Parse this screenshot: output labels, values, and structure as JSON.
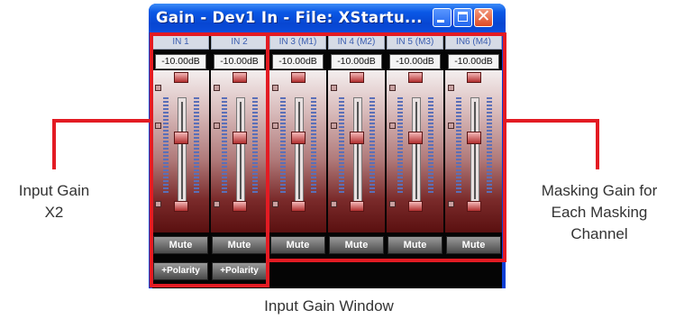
{
  "window": {
    "title": "Gain - Dev1 In  -  File: XStartu...",
    "controls": {
      "minimize": "minimize-icon",
      "maximize": "maximize-icon",
      "close": "close-icon",
      "close_glyph": "✕"
    }
  },
  "channels": [
    {
      "label": "IN 1",
      "gain": "-10.00dB",
      "mute": "Mute",
      "polarity": "+Polarity"
    },
    {
      "label": "IN 2",
      "gain": "-10.00dB",
      "mute": "Mute",
      "polarity": "+Polarity"
    },
    {
      "label": "IN 3 (M1)",
      "gain": "-10.00dB",
      "mute": "Mute"
    },
    {
      "label": "IN 4 (M2)",
      "gain": "-10.00dB",
      "mute": "Mute"
    },
    {
      "label": "IN 5 (M3)",
      "gain": "-10.00dB",
      "mute": "Mute"
    },
    {
      "label": "IN6 (M4)",
      "gain": "-10.00dB",
      "mute": "Mute"
    }
  ],
  "annotations": {
    "left_line1": "Input Gain",
    "left_line2": "X2",
    "right_line1": "Masking Gain for",
    "right_line2": "Each Masking",
    "right_line3": "Channel",
    "caption": "Input Gain Window"
  },
  "colors": {
    "highlight": "#e31b23",
    "titlebar": "#0a58e6"
  }
}
